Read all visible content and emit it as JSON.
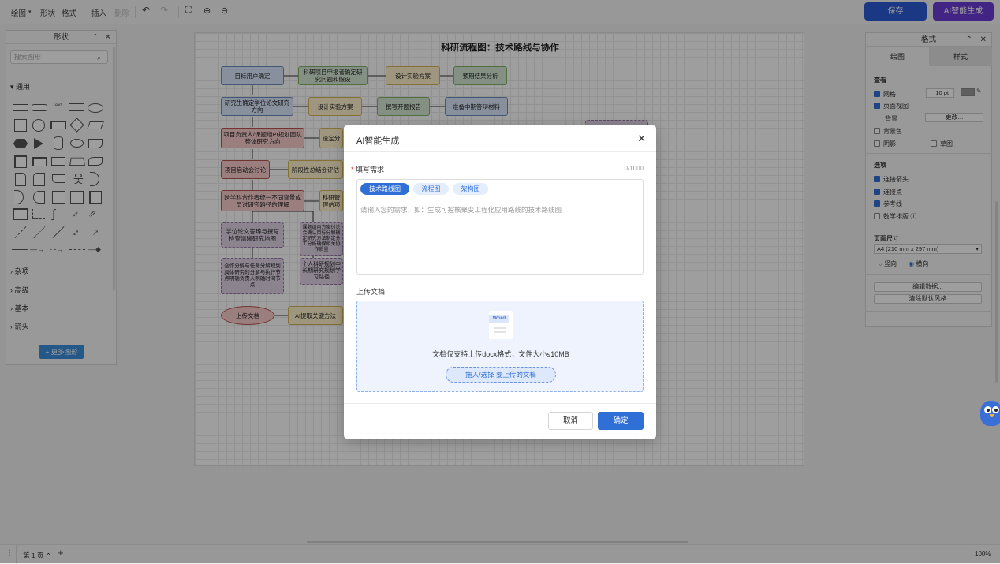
{
  "toolbar": {
    "draw": "绘图",
    "shape": "形状",
    "format": "格式",
    "insert": "插入",
    "delete": "删除",
    "save": "保存",
    "ai_generate": "AI智能生成",
    "save_color": "#2c5bd6",
    "ai_color": "#6a3bd6"
  },
  "shapes_panel": {
    "title": "形状",
    "search_placeholder": "搜索图形",
    "general": "通用",
    "misc": "杂项",
    "advanced": "高级",
    "basic": "基本",
    "arrows": "箭头",
    "more_shapes": "+ 更多图形"
  },
  "diagram": {
    "title": "科研流程图：技术路线与协作",
    "nodes": [
      "目标用户确定",
      "科研项目申报者确定研究问题和假设",
      "设计实验方案",
      "预期结果分析",
      "研究生确定学位论文研究方向",
      "设计实验方案",
      "撰写开题报告",
      "准备中期答辩材料",
      "项目负责人/课题组PI规划团队整体研究方向",
      "设定分",
      "项目启动会讨论",
      "阶段性总结会评估",
      "跨学科合作者统一不同背景成员对研究路径的理解",
      "科研管理估项",
      "学位论文答辩与撰写检查清晰研究地图",
      "课题组内方案讨论会确认目标分解确定研究方法制定分工分析确保相关协作质量",
      "合作分解与任务分解规划具体研究的分解与执行节点明确负责人明确时间节点",
      "个人科研规划中长期研究规划学习路径",
      "上传文档",
      "AI提取关键方法"
    ]
  },
  "format_panel": {
    "title": "格式",
    "tab_draw": "绘图",
    "tab_style": "样式",
    "view": "查看",
    "grid": "网格",
    "grid_size": "10 pt",
    "page_view": "页面视图",
    "background": "背景",
    "change": "更改...",
    "bg_color": "背景色",
    "shadow": "阴影",
    "sketch": "草图",
    "options": "选项",
    "connection_arrows": "连接箭头",
    "connection_points": "连接点",
    "guides": "参考线",
    "math": "数学排版",
    "page_size": "页面尺寸",
    "paper_size": "A4 (210 mm x 297 mm)",
    "portrait": "竖向",
    "landscape": "横向",
    "edit_data": "编辑数据...",
    "clear_style": "清除默认风格"
  },
  "modal": {
    "title": "AI智能生成",
    "requirement_label": "填写需求",
    "required_mark": "*",
    "counter": "0/1000",
    "chips": [
      "技术路线图",
      "流程图",
      "架构图"
    ],
    "textarea_placeholder": "请输入您的需求，如：生成可控核聚变工程化应用路线的技术路线图",
    "upload_label": "上传文档",
    "word_label": "Word",
    "upload_hint": "文档仅支持上传docx格式，文件大小≤10MB",
    "upload_button": "拖入/选择 要上传的文档",
    "cancel": "取消",
    "confirm": "确定",
    "primary_color": "#2f6fd6"
  },
  "statusbar": {
    "page": "第 1 页",
    "zoom": "100%"
  }
}
